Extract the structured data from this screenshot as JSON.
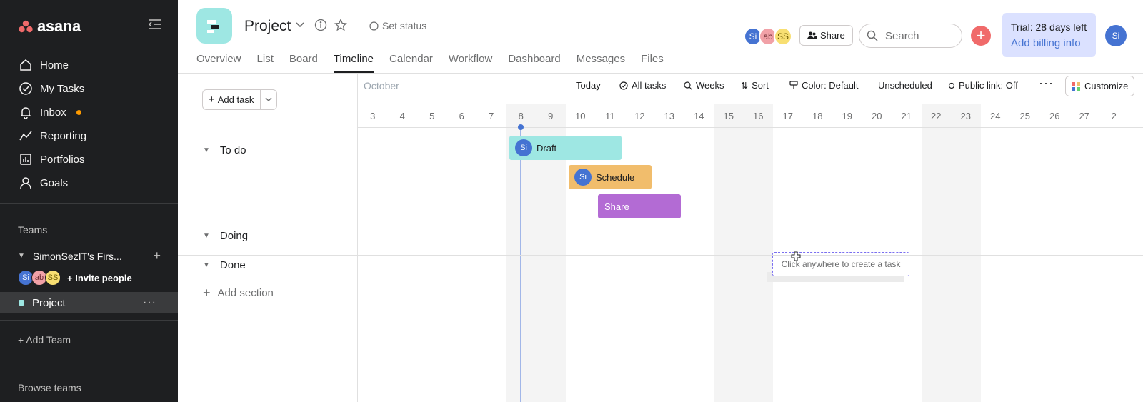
{
  "sidebar": {
    "logo": "asana",
    "nav": [
      {
        "label": "Home",
        "icon": "home-icon"
      },
      {
        "label": "My Tasks",
        "icon": "check-circle-icon"
      },
      {
        "label": "Inbox",
        "icon": "bell-icon"
      },
      {
        "label": "Reporting",
        "icon": "reporting-icon"
      },
      {
        "label": "Portfolios",
        "icon": "portfolios-icon"
      },
      {
        "label": "Goals",
        "icon": "goals-icon"
      }
    ],
    "teams_heading": "Teams",
    "team_name": "SimonSezIT's Firs...",
    "members": [
      "Si",
      "ab",
      "SS"
    ],
    "invite_label": "Invite people",
    "project_label": "Project",
    "add_team_label": "Add Team",
    "browse_teams_label": "Browse teams"
  },
  "header": {
    "project_title": "Project",
    "set_status": "Set status",
    "tabs": [
      "Overview",
      "List",
      "Board",
      "Timeline",
      "Calendar",
      "Workflow",
      "Dashboard",
      "Messages",
      "Files"
    ],
    "active_tab": "Timeline",
    "members": [
      "Si",
      "ab",
      "SS"
    ],
    "share_label": "Share",
    "search_placeholder": "Search",
    "trial_text": "Trial: 28 days left",
    "billing_link": "Add billing info",
    "user_initials": "Si"
  },
  "toolbar": {
    "add_task_label": "Add task",
    "month": "October",
    "today": "Today",
    "all_tasks": "All tasks",
    "weeks": "Weeks",
    "sort": "Sort",
    "color": "Color: Default",
    "unscheduled": "Unscheduled",
    "public_link": "Public link: Off",
    "customize": "Customize"
  },
  "timeline": {
    "days": [
      "3",
      "4",
      "5",
      "6",
      "7",
      "8",
      "9",
      "10",
      "11",
      "12",
      "13",
      "14",
      "15",
      "16",
      "17",
      "18",
      "19",
      "20",
      "21",
      "22",
      "23",
      "24",
      "25",
      "26",
      "27",
      "2"
    ],
    "sections": [
      "To do",
      "Doing",
      "Done"
    ],
    "add_section_label": "Add section",
    "tasks": [
      {
        "name": "Draft",
        "assignee": "Si",
        "color": "#9ee7e3"
      },
      {
        "name": "Schedule",
        "assignee": "Si",
        "color": "#f1bd6c"
      },
      {
        "name": "Share",
        "assignee": "",
        "color": "#b36bd4"
      }
    ],
    "create_hint": "Click anywhere to create a task"
  },
  "colors": {
    "sidebar_bg": "#1e1f21",
    "accent_red": "#f06a6a",
    "accent_blue": "#4573d2"
  }
}
